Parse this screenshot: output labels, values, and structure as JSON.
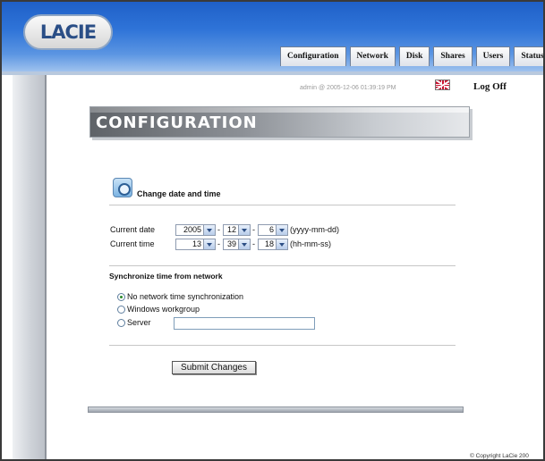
{
  "app": {
    "logo_text": "LACIE"
  },
  "tabs": [
    {
      "label": "Configuration"
    },
    {
      "label": "Network"
    },
    {
      "label": "Disk"
    },
    {
      "label": "Shares"
    },
    {
      "label": "Users"
    },
    {
      "label": "Status"
    }
  ],
  "status": {
    "user_time": "admin @ 2005-12-06 01:39:19 PM",
    "logoff_label": "Log Off",
    "flag_icon": "uk-flag-icon"
  },
  "page": {
    "banner_title": "CONFIGURATION"
  },
  "datetime": {
    "section_title": "Change date and time",
    "date_label": "Current date",
    "date_year": "2005",
    "date_month": "12",
    "date_day": "6",
    "date_format": "(yyyy-mm-dd)",
    "time_label": "Current time",
    "time_hour": "13",
    "time_minute": "39",
    "time_second": "18",
    "time_format": "(hh-mm-ss)"
  },
  "sync": {
    "title": "Synchronize time from network",
    "options": [
      {
        "label": "No network time synchronization",
        "selected": true
      },
      {
        "label": "Windows workgroup",
        "selected": false
      },
      {
        "label": "Server",
        "selected": false
      }
    ],
    "server_value": ""
  },
  "actions": {
    "submit_label": "Submit Changes"
  },
  "footer": {
    "copyright": "© Copyright LaCie 200"
  }
}
